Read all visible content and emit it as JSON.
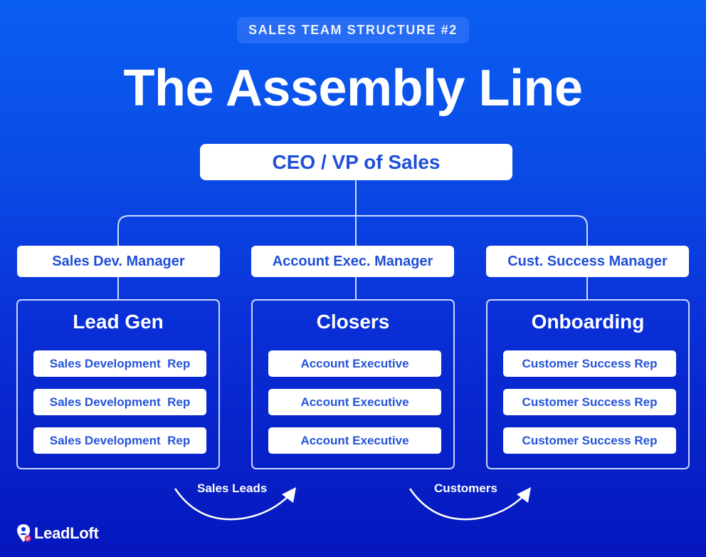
{
  "header": {
    "eyebrow": "SALES TEAM STRUCTURE #2",
    "title": "The Assembly Line"
  },
  "org": {
    "root": "CEO / VP of Sales",
    "managers": [
      "Sales Dev. Manager",
      "Account Exec. Manager",
      "Cust. Success Manager"
    ],
    "teams": [
      {
        "name": "Lead Gen",
        "members": [
          "Sales Development  Rep",
          "Sales Development  Rep",
          "Sales Development  Rep"
        ]
      },
      {
        "name": "Closers",
        "members": [
          "Account Executive",
          "Account Executive",
          "Account Executive"
        ]
      },
      {
        "name": "Onboarding",
        "members": [
          "Customer Success Rep",
          "Customer Success Rep",
          "Customer Success Rep"
        ]
      }
    ]
  },
  "flows": [
    {
      "label": "Sales Leads",
      "from": "Lead Gen",
      "to": "Closers"
    },
    {
      "label": "Customers",
      "from": "Closers",
      "to": "Onboarding"
    }
  ],
  "brand": {
    "name": "LeadLoft",
    "icon": "map-pin-user-icon",
    "accent": "#e2387a"
  },
  "colors": {
    "background_top": "#0b5ef2",
    "background_bottom": "#0616bd",
    "box_text": "#1f4fd6",
    "lines": "#cfdcff"
  }
}
